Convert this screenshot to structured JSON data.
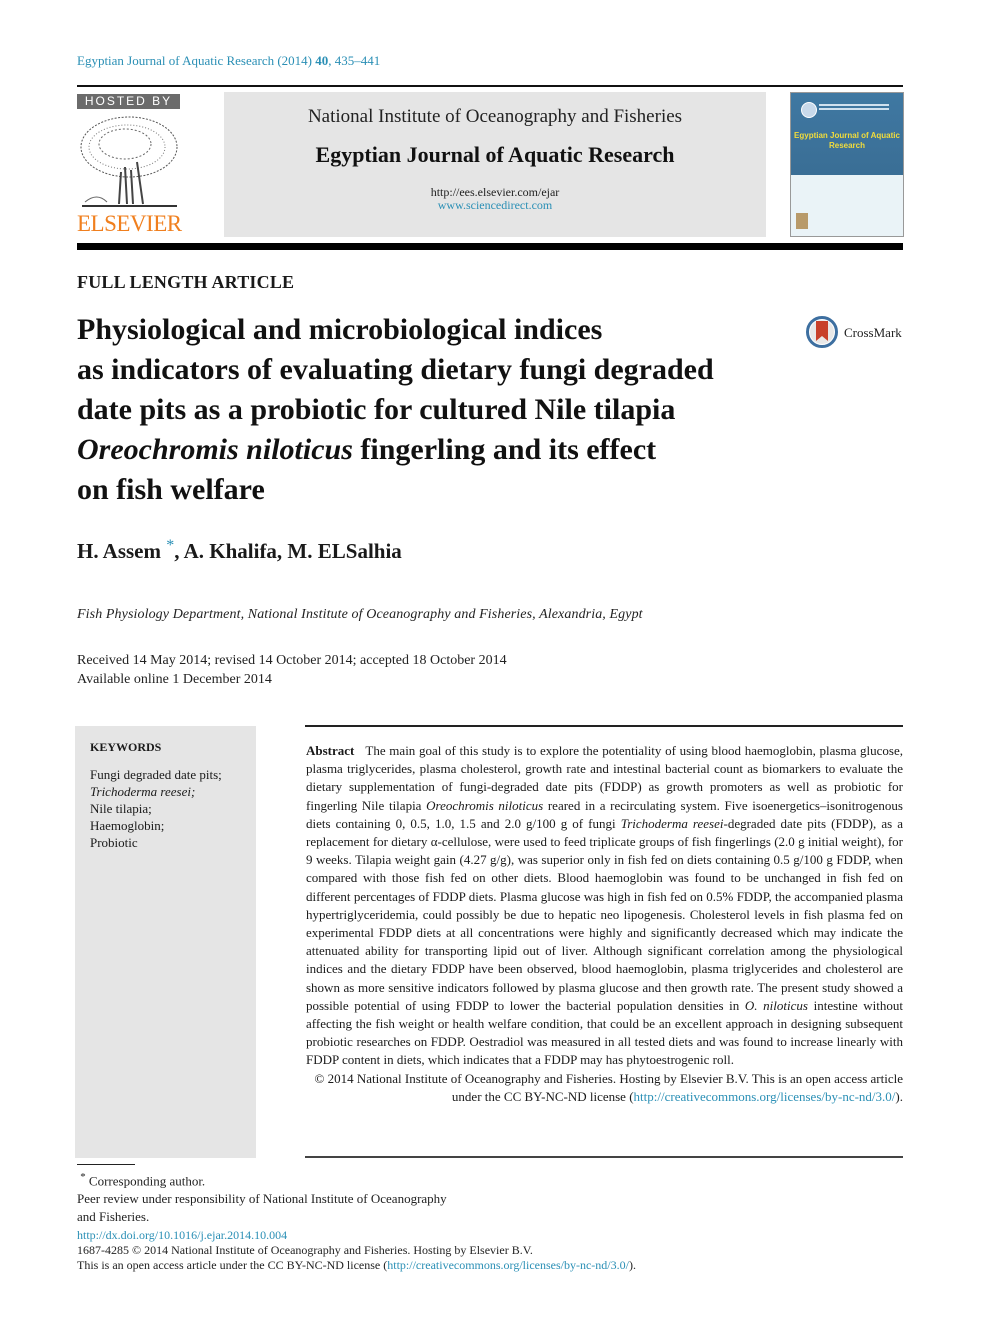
{
  "citation": {
    "journal": "Egyptian Journal of Aquatic Research (2014)",
    "volume": "40",
    "pages": ", 435–441"
  },
  "header": {
    "hosted_by": "HOSTED BY",
    "publisher_logo_text": "ELSEVIER",
    "institution": "National Institute of Oceanography and Fisheries",
    "journal_name": "Egyptian Journal of Aquatic Research",
    "journal_url": "http://ees.elsevier.com/ejar",
    "sciencedirect_url": "www.sciencedirect.com",
    "cover_title": "Egyptian Journal of Aquatic Research",
    "cover_brand_color": "#3f78a2",
    "cover_title_color": "#f2dc3b"
  },
  "article": {
    "type": "FULL LENGTH ARTICLE",
    "title_line1": "Physiological and microbiological indices",
    "title_line2": "as indicators of evaluating dietary fungi degraded",
    "title_line3": "date pits as a probiotic for cultured Nile tilapia",
    "title_line4_italic": "Oreochromis niloticus",
    "title_line4_rest": " fingerling and its effect",
    "title_line5": "on fish welfare",
    "crossmark_label": "CrossMark",
    "authors_first": "H. Assem",
    "authors_star": "*",
    "authors_rest": ", A. Khalifa, M. ELSalhia",
    "affiliation": "Fish Physiology Department, National Institute of Oceanography and Fisheries, Alexandria, Egypt",
    "dates_received": "Received 14 May 2014; revised 14 October 2014; accepted 18 October 2014",
    "dates_online": "Available online 1 December 2014"
  },
  "keywords": {
    "heading": "KEYWORDS",
    "items": [
      "Fungi degraded date pits;",
      "Trichoderma reesei;",
      "Nile tilapia;",
      "Haemoglobin;",
      "Probiotic"
    ]
  },
  "abstract": {
    "label": "Abstract",
    "part1": "The main goal of this study is to explore the potentiality of using blood haemoglobin, plasma glucose, plasma triglycerides, plasma cholesterol, growth rate and intestinal bacterial count as biomarkers to evaluate the dietary supplementation of fungi-degraded date pits (FDDP) as growth promoters as well as probiotic for fingerling Nile tilapia ",
    "italic1": "Oreochromis niloticus",
    "part2": " reared in a recirculating system. Five isoenergetics–isonitrogenous diets containing 0, 0.5, 1.0, 1.5 and 2.0 g/100 g of fungi ",
    "italic2": "Trichoderma reesei",
    "part3": "-degraded date pits (FDDP), as a replacement for dietary α-cellulose, were used to feed triplicate groups of fish fingerlings (2.0 g initial weight), for 9 weeks. Tilapia weight gain (4.27 g/g), was superior only in fish fed on diets containing 0.5 g/100 g FDDP, when compared with those fish fed on other diets. Blood haemoglobin was found to be unchanged in fish fed on different percentages of FDDP diets. Plasma glucose was high in fish fed on 0.5% FDDP, the accompanied plasma hypertriglyceridemia, could possibly be due to hepatic neo lipogenesis. Cholesterol levels in fish plasma fed on experimental FDDP diets at all concentrations were highly and significantly decreased which may indicate the attenuated ability for transporting lipid out of liver. Although significant correlation among the physiological indices and the dietary FDDP have been observed, blood haemoglobin, plasma triglycerides and cholesterol are shown as more sensitive indicators followed by plasma glucose and then growth rate. The present study showed a possible potential of using FDDP to lower the bacterial population densities in ",
    "italic3": "O. niloticus",
    "part4": " intestine without affecting the fish weight or health welfare condition, that could be an excellent approach in designing subsequent probiotic researches on FDDP. Oestradiol was measured in all tested diets and was found to increase linearly with FDDP content in diets, which indicates that a FDDP may has phytoestrogenic roll.",
    "copyright": "© 2014 National Institute of Oceanography and Fisheries. Hosting by Elsevier B.V. This is an open access article under the CC BY-NC-ND license (",
    "license_url": "http://creativecommons.org/licenses/by-nc-nd/3.0/",
    "copyright_end": ")."
  },
  "footnotes": {
    "star": "*",
    "corresponding": "Corresponding author.",
    "peer_review_1": "Peer review under responsibility of National Institute of Oceanography",
    "peer_review_2": "and Fisheries."
  },
  "footer": {
    "doi_url": "http://dx.doi.org/10.1016/j.ejar.2014.10.004",
    "issn_line": "1687-4285 © 2014 National Institute of Oceanography and Fisheries. Hosting by Elsevier B.V.",
    "license_prefix": "This is an open access article under the CC BY-NC-ND license (",
    "license_url": "http://creativecommons.org/licenses/by-nc-nd/3.0/",
    "license_suffix": ")."
  },
  "colors": {
    "link": "#2a8fb5",
    "elsevier_orange": "#f07f1e",
    "panel_gray": "#e5e5e5"
  }
}
